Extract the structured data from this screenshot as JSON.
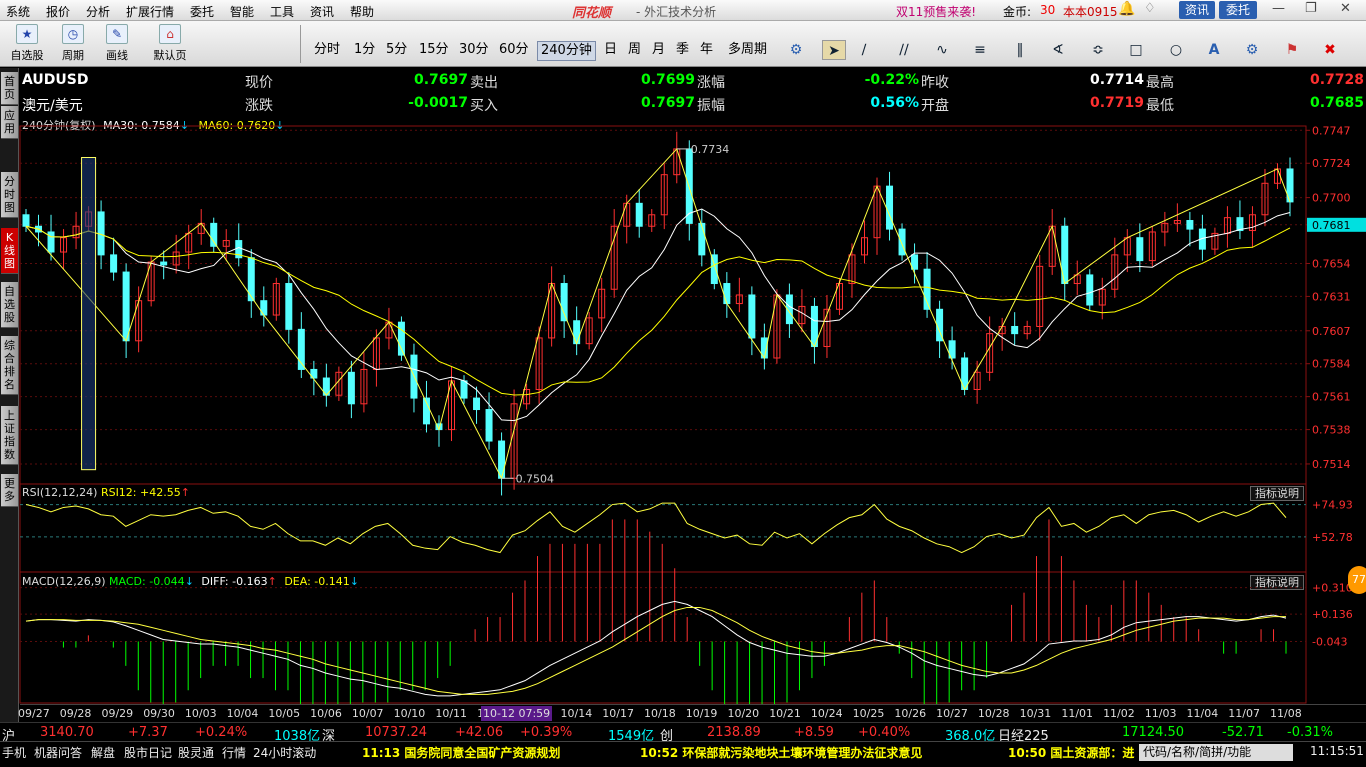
{
  "menu": [
    "系统",
    "报价",
    "分析",
    "扩展行情",
    "委托",
    "智能",
    "工具",
    "资讯",
    "帮助"
  ],
  "app": {
    "logo": "同花顺",
    "title": "- 外汇技术分析",
    "promo": "双11预售来袭!",
    "gold_label": "金币:",
    "gold_value": "30",
    "version": "本本0915",
    "news_btn": "资讯",
    "trade_btn": "委托"
  },
  "toolbar": {
    "buttons": [
      {
        "label": "自选股"
      },
      {
        "label": "周期"
      },
      {
        "label": "画线"
      },
      {
        "label": "默认页"
      }
    ],
    "periods": [
      "分时",
      "1分",
      "5分",
      "15分",
      "30分",
      "60分",
      "240分钟",
      "日",
      "周",
      "月",
      "季",
      "年",
      "多周期"
    ],
    "active_period": "240分钟"
  },
  "sidebar": [
    "首页",
    "应用",
    "分时图",
    "K线图",
    "自选股",
    "综合排名",
    "上证指数",
    "更多"
  ],
  "quote": {
    "symbol": "AUDUSD",
    "name": "澳元/美元",
    "fields": [
      {
        "label": "现价",
        "value": "0.7697",
        "color": "#00ff00"
      },
      {
        "label": "卖出",
        "value": "0.7699",
        "color": "#00ff00"
      },
      {
        "label": "涨幅",
        "value": "-0.22%",
        "color": "#00ff00"
      },
      {
        "label": "昨收",
        "value": "0.7714",
        "color": "#ffffff"
      },
      {
        "label": "最高",
        "value": "0.7728",
        "color": "#ff3030"
      },
      {
        "label": "涨跌",
        "value": "-0.0017",
        "color": "#00ff00"
      },
      {
        "label": "买入",
        "value": "0.7697",
        "color": "#00ff00"
      },
      {
        "label": "振幅",
        "value": "0.56%",
        "color": "#00ffff"
      },
      {
        "label": "开盘",
        "value": "0.7719",
        "color": "#ff3030"
      },
      {
        "label": "最低",
        "value": "0.7685",
        "color": "#00ff00"
      }
    ]
  },
  "main_legend": {
    "period": "240分钟(复权)",
    "ma30": "MA30: 0.7584",
    "ma60": "MA60: 0.7620",
    "ma30_color": "#ffffff",
    "ma60_color": "#ffff00"
  },
  "rsi_legend": {
    "name": "RSI(12,12,24)",
    "value": "RSI12: +42.55"
  },
  "macd_legend": {
    "name": "MACD(12,26,9)",
    "macd": "MACD: -0.044",
    "diff": "DIFF: -0.163",
    "dea": "DEA: -0.141"
  },
  "indicator_btn": "指标说明",
  "chart_data": [
    {
      "type": "candlestick",
      "title": "AUDUSD 240分钟",
      "y_ticks": [
        "0.7747",
        "0.7724",
        "0.7700",
        "0.7681",
        "0.7654",
        "0.7631",
        "0.7607",
        "0.7584",
        "0.7561",
        "0.7538",
        "0.7514"
      ],
      "ylim": [
        0.75,
        0.775
      ],
      "current_price": 0.7681,
      "annotations": [
        {
          "text": "0.7734",
          "value": 0.7734
        },
        {
          "text": "0.7504",
          "value": 0.7504
        }
      ],
      "x_labels": [
        "09/27",
        "09/28",
        "09/29",
        "09/30",
        "10/03",
        "10/04",
        "10/05",
        "10/06",
        "10/07",
        "10/10",
        "10/11",
        "10/12",
        "10/13",
        "10/14",
        "10/17",
        "10/18",
        "10/19",
        "10/20",
        "10/21",
        "10/24",
        "10/25",
        "10/26",
        "10/27",
        "10/28",
        "10/31",
        "11/01",
        "11/02",
        "11/03",
        "11/04",
        "11/07",
        "11/08"
      ],
      "crosshair_label": "10-12 07:59",
      "close": [
        0.768,
        0.7676,
        0.7662,
        0.7672,
        0.768,
        0.769,
        0.766,
        0.7648,
        0.76,
        0.7628,
        0.7655,
        0.7653,
        0.7662,
        0.7675,
        0.7682,
        0.7666,
        0.767,
        0.7658,
        0.7628,
        0.7618,
        0.764,
        0.7608,
        0.758,
        0.7574,
        0.7562,
        0.7578,
        0.7556,
        0.758,
        0.7602,
        0.7613,
        0.759,
        0.756,
        0.7542,
        0.7538,
        0.7572,
        0.756,
        0.7552,
        0.753,
        0.7504,
        0.7556,
        0.7566,
        0.7602,
        0.764,
        0.7614,
        0.7598,
        0.7616,
        0.7636,
        0.768,
        0.7696,
        0.768,
        0.7688,
        0.7716,
        0.7734,
        0.7682,
        0.766,
        0.764,
        0.7626,
        0.7632,
        0.7602,
        0.7588,
        0.7632,
        0.7612,
        0.7624,
        0.7596,
        0.7622,
        0.764,
        0.766,
        0.7672,
        0.7708,
        0.7678,
        0.766,
        0.765,
        0.7622,
        0.76,
        0.7588,
        0.7566,
        0.7578,
        0.7605,
        0.761,
        0.7605,
        0.761,
        0.7652,
        0.768,
        0.764,
        0.7646,
        0.7625,
        0.7636,
        0.766,
        0.7672,
        0.7656,
        0.7676,
        0.7682,
        0.7684,
        0.7678,
        0.7664,
        0.7675,
        0.7686,
        0.7677,
        0.7688,
        0.771,
        0.772,
        0.7697
      ]
    },
    {
      "type": "line",
      "title": "RSI(12,12,24)",
      "y_ticks": [
        "+74.93",
        "+52.78"
      ],
      "ylim": [
        30,
        85
      ],
      "series": [
        {
          "name": "RSI12",
          "values": [
            75,
            73,
            70,
            73,
            74,
            72,
            68,
            67,
            60,
            64,
            68,
            67,
            68,
            71,
            73,
            69,
            70,
            67,
            60,
            58,
            62,
            55,
            50,
            50,
            47,
            52,
            48,
            55,
            60,
            62,
            55,
            47,
            45,
            44,
            53,
            49,
            47,
            44,
            42,
            54,
            57,
            64,
            70,
            60,
            56,
            62,
            68,
            75,
            76,
            70,
            72,
            76,
            76,
            62,
            58,
            55,
            52,
            54,
            48,
            47,
            56,
            52,
            55,
            48,
            55,
            61,
            66,
            68,
            75,
            65,
            60,
            57,
            52,
            48,
            46,
            42,
            46,
            53,
            55,
            52,
            54,
            66,
            73,
            60,
            62,
            56,
            60,
            66,
            68,
            62,
            68,
            70,
            71,
            68,
            63,
            67,
            70,
            67,
            70,
            75,
            76,
            66
          ]
        }
      ]
    },
    {
      "type": "bar+line",
      "title": "MACD(12,26,9)",
      "y_ticks": [
        "+0.310",
        "+0.136",
        "-0.043"
      ],
      "ylim": [
        -0.44,
        0.36
      ],
      "series": [
        {
          "name": "DIFF",
          "values": [
            0.09,
            0.1,
            0.1,
            0.095,
            0.09,
            0.1,
            0.095,
            0.085,
            0.06,
            0.03,
            0.0,
            -0.03,
            -0.04,
            -0.05,
            -0.06,
            -0.06,
            -0.07,
            -0.08,
            -0.1,
            -0.12,
            -0.14,
            -0.16,
            -0.2,
            -0.22,
            -0.25,
            -0.27,
            -0.29,
            -0.3,
            -0.32,
            -0.34,
            -0.35,
            -0.37,
            -0.39,
            -0.4,
            -0.4,
            -0.39,
            -0.38,
            -0.37,
            -0.36,
            -0.33,
            -0.3,
            -0.25,
            -0.2,
            -0.16,
            -0.12,
            -0.08,
            -0.04,
            0.02,
            0.07,
            0.12,
            0.16,
            0.2,
            0.22,
            0.2,
            0.16,
            0.12,
            0.06,
            0.0,
            -0.05,
            -0.08,
            -0.1,
            -0.12,
            -0.13,
            -0.14,
            -0.14,
            -0.12,
            -0.09,
            -0.06,
            -0.03,
            -0.05,
            -0.08,
            -0.12,
            -0.17,
            -0.2,
            -0.22,
            -0.24,
            -0.26,
            -0.27,
            -0.25,
            -0.22,
            -0.19,
            -0.13,
            -0.06,
            -0.05,
            -0.04,
            -0.04,
            -0.03,
            0.0,
            0.05,
            0.08,
            0.09,
            0.1,
            0.11,
            0.12,
            0.12,
            0.11,
            0.1,
            0.09,
            0.1,
            0.12,
            0.13,
            0.11
          ]
        },
        {
          "name": "DEA",
          "values": [
            0.09,
            0.1,
            0.1,
            0.1,
            0.095,
            0.095,
            0.095,
            0.09,
            0.08,
            0.07,
            0.05,
            0.03,
            0.01,
            -0.01,
            -0.03,
            -0.04,
            -0.05,
            -0.06,
            -0.07,
            -0.09,
            -0.1,
            -0.12,
            -0.14,
            -0.16,
            -0.19,
            -0.21,
            -0.23,
            -0.25,
            -0.27,
            -0.29,
            -0.31,
            -0.33,
            -0.35,
            -0.37,
            -0.38,
            -0.39,
            -0.39,
            -0.39,
            -0.38,
            -0.37,
            -0.35,
            -0.32,
            -0.28,
            -0.24,
            -0.2,
            -0.16,
            -0.12,
            -0.08,
            -0.03,
            0.02,
            0.07,
            0.12,
            0.16,
            0.18,
            0.18,
            0.16,
            0.12,
            0.08,
            0.03,
            -0.01,
            -0.04,
            -0.07,
            -0.09,
            -0.11,
            -0.12,
            -0.12,
            -0.11,
            -0.1,
            -0.08,
            -0.07,
            -0.07,
            -0.09,
            -0.11,
            -0.14,
            -0.17,
            -0.2,
            -0.22,
            -0.24,
            -0.25,
            -0.25,
            -0.23,
            -0.2,
            -0.16,
            -0.12,
            -0.09,
            -0.07,
            -0.05,
            -0.03,
            0.0,
            0.03,
            0.05,
            0.07,
            0.09,
            0.1,
            0.11,
            0.11,
            0.11,
            0.1,
            0.1,
            0.11,
            0.12,
            0.12
          ]
        }
      ]
    }
  ],
  "indexbar": [
    {
      "text": "沪",
      "color": "#eeeeee"
    },
    {
      "text": "3140.70",
      "color": "#ff3030"
    },
    {
      "text": "+7.37",
      "color": "#ff3030"
    },
    {
      "text": "+0.24%",
      "color": "#ff3030"
    },
    {
      "text": "1038亿",
      "color": "#00ffff"
    },
    {
      "text": "深",
      "color": "#eeeeee"
    },
    {
      "text": "10737.24",
      "color": "#ff3030"
    },
    {
      "text": "+42.06",
      "color": "#ff3030"
    },
    {
      "text": "+0.39%",
      "color": "#ff3030"
    },
    {
      "text": "1549亿",
      "color": "#00ffff"
    },
    {
      "text": "创",
      "color": "#eeeeee"
    },
    {
      "text": "2138.89",
      "color": "#ff3030"
    },
    {
      "text": "+8.59",
      "color": "#ff3030"
    },
    {
      "text": "+0.40%",
      "color": "#ff3030"
    },
    {
      "text": "368.0亿",
      "color": "#00ffff"
    },
    {
      "text": "日经225",
      "color": "#eeeeee"
    },
    {
      "text": "17124.50",
      "color": "#00ff00"
    },
    {
      "text": "-52.71",
      "color": "#00ff00"
    },
    {
      "text": "-0.31%",
      "color": "#00ff00"
    }
  ],
  "statusbar": {
    "tabs": [
      "手机",
      "机器问答",
      "解盘",
      "股市日记",
      "股灵通",
      "行情",
      "24小时滚动"
    ],
    "news": [
      "11:13 国务院同意全国矿产资源规划",
      "10:52 环保部就污染地块土壤环境管理办法征求意见",
      "10:50 国土资源部：进"
    ],
    "code_placeholder": "代码/名称/简拼/功能",
    "clock": "11:15:51"
  }
}
